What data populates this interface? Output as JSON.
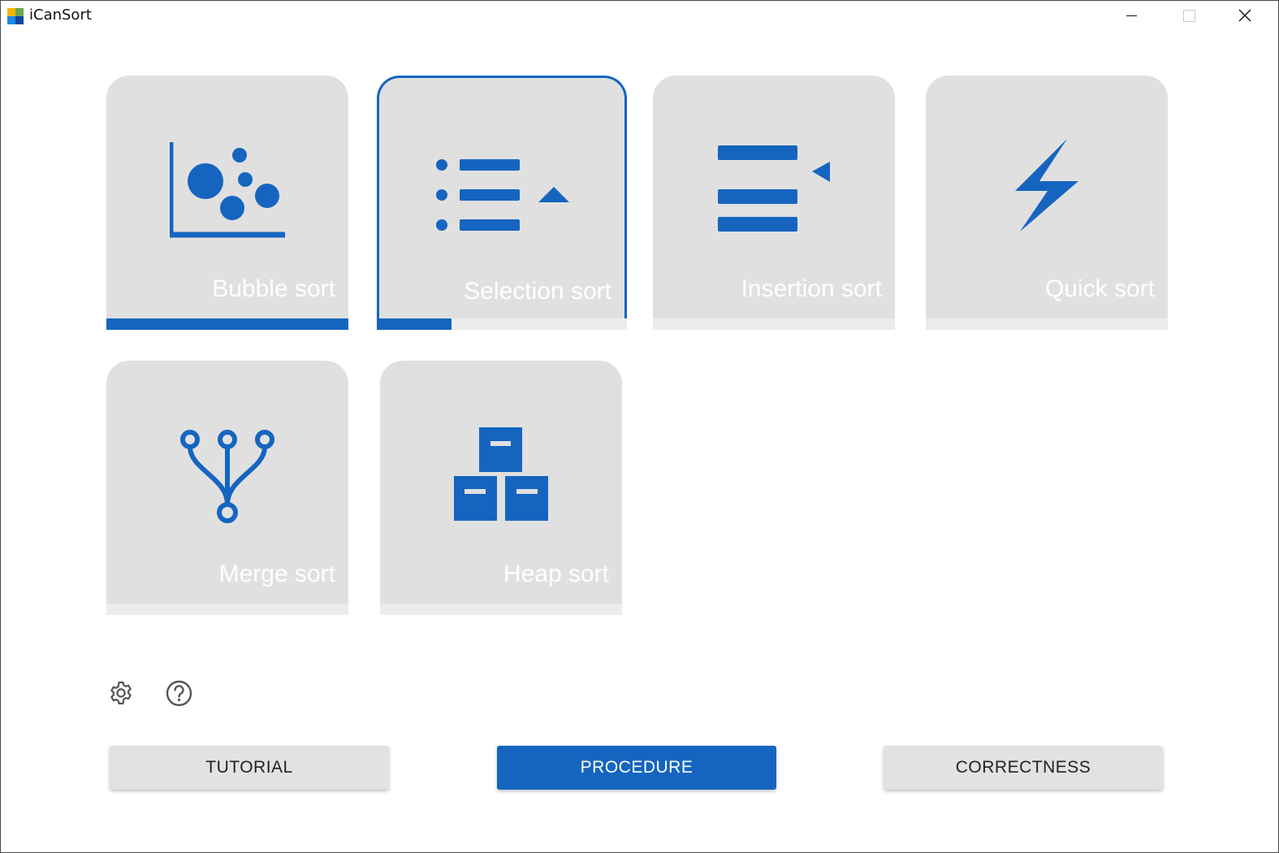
{
  "window": {
    "title": "iCanSort"
  },
  "accent_color": "#1565c0",
  "cards": [
    {
      "label": "Bubble sort",
      "icon": "bubble-chart-icon",
      "progress": 1.0,
      "selected": false
    },
    {
      "label": "Selection sort",
      "icon": "selection-list-icon",
      "progress": 0.3,
      "selected": true
    },
    {
      "label": "Insertion sort",
      "icon": "insertion-list-icon",
      "progress": 0.0,
      "selected": false
    },
    {
      "label": "Quick sort",
      "icon": "lightning-icon",
      "progress": 0.0,
      "selected": false
    },
    {
      "label": "Merge sort",
      "icon": "merge-tree-icon",
      "progress": 0.0,
      "selected": false
    },
    {
      "label": "Heap sort",
      "icon": "stacked-boxes-icon",
      "progress": 0.0,
      "selected": false
    }
  ],
  "toolbar": {
    "settings_icon": "gear-icon",
    "help_icon": "help-circle-icon"
  },
  "buttons": {
    "tutorial": "TUTORIAL",
    "procedure": "PROCEDURE",
    "correctness": "CORRECTNESS"
  }
}
